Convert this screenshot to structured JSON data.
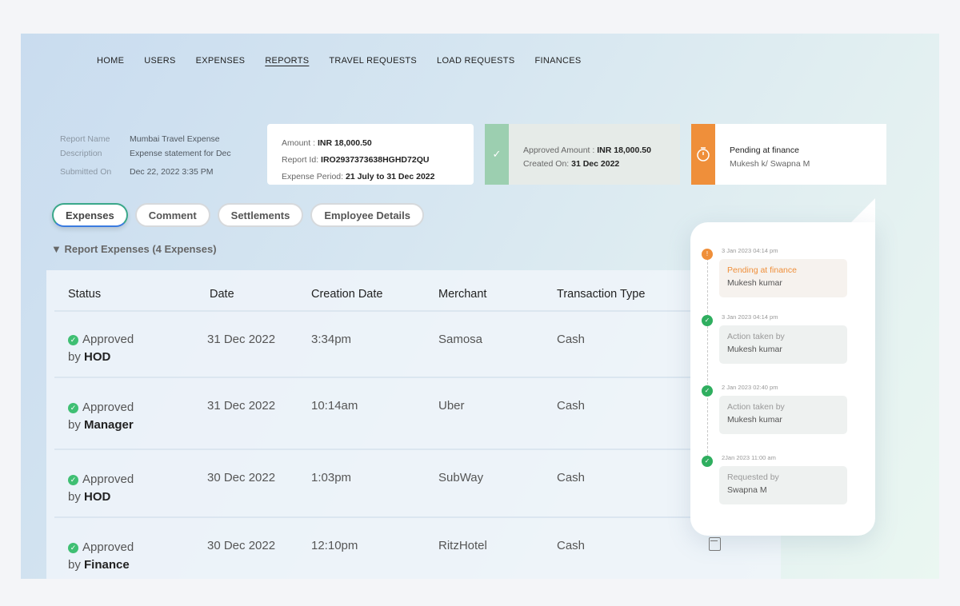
{
  "nav": [
    "HOME",
    "USERS",
    "EXPENSES",
    "REPORTS",
    "TRAVEL REQUESTS",
    "LOAD REQUESTS",
    "FINANCES"
  ],
  "nav_active": "REPORTS",
  "meta": [
    {
      "k": "Report Name",
      "v": "Mumbai Travel Expense"
    },
    {
      "k": "Description",
      "v": "Expense statement for Dec"
    },
    {
      "k": "Submitted On",
      "v": "Dec 22, 2022 3:35 PM"
    }
  ],
  "summary": {
    "amount_label": "Amount :",
    "amount": "INR 18,000.50",
    "id_label": "Report Id:",
    "id": "IRO2937373638HGHD72QU",
    "period_label": "Expense Period:",
    "period": "21 July to 31 Dec 2022"
  },
  "approved": {
    "amount_label": "Approved Amount :",
    "amount": "INR 18,000.50",
    "created_label": "Created On:",
    "created": "31 Dec  2022"
  },
  "pending": {
    "title": "Pending at finance",
    "people": "Mukesh k/ Swapna M"
  },
  "tabs": [
    "Expenses",
    "Comment",
    "Settlements",
    "Employee Details"
  ],
  "section": "Report Expenses (4 Expenses)",
  "table": {
    "headers": [
      "Status",
      "Date",
      "Creation Date",
      "Merchant",
      "Transaction Type"
    ],
    "rows": [
      {
        "status": "Approved",
        "by": "HOD",
        "date": "31 Dec 2022",
        "time": "3:34pm",
        "merchant": "Samosa",
        "type": "Cash"
      },
      {
        "status": "Approved",
        "by": "Manager",
        "date": "31 Dec 2022",
        "time": "10:14am",
        "merchant": "Uber",
        "type": "Cash"
      },
      {
        "status": "Approved",
        "by": "HOD",
        "date": "30 Dec 2022",
        "time": "1:03pm",
        "merchant": "SubWay",
        "type": "Cash"
      },
      {
        "status": "Approved",
        "by": "Finance",
        "date": "30 Dec 2022",
        "time": "12:10pm",
        "merchant": "RitzHotel",
        "type": "Cash"
      }
    ]
  },
  "by_label": "by",
  "timeline": [
    {
      "date": "3 Jan 2023  04:14 pm",
      "a": "Pending at finance",
      "b": "Mukesh kumar",
      "state": "pending"
    },
    {
      "date": "3 Jan 2023  04:14 pm",
      "a": "Action taken by",
      "b": "Mukesh kumar",
      "state": "done"
    },
    {
      "date": "2 Jan 2023  02:40 pm",
      "a": "Action taken by",
      "b": "Mukesh kumar",
      "state": "done"
    },
    {
      "date": "2Jan 2023  11:00 am",
      "a": "Requested by",
      "b": "Swapna M",
      "state": "done"
    }
  ],
  "colors": {
    "green": "#3fbf73",
    "orange": "#ef8f3a"
  }
}
